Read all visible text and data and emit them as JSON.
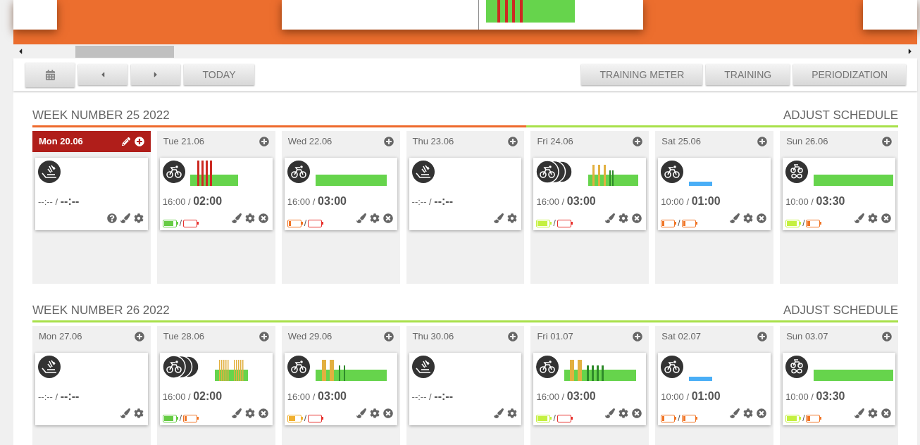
{
  "toolbar": {
    "left_buttons": [
      {
        "kind": "calendar"
      },
      {
        "kind": "prev"
      },
      {
        "kind": "next"
      },
      {
        "kind": "text",
        "label": "TODAY"
      }
    ],
    "right_buttons": [
      "TRAINING METER",
      "TRAINING",
      "PERIODIZATION"
    ]
  },
  "weeks": [
    {
      "title": "WEEK NUMBER 25 2022",
      "action": "ADJUST SCHEDULE",
      "level": 0.43,
      "days": [
        {
          "label": "Mon 20.06",
          "selected": true,
          "card": {
            "kind": "rest",
            "time": "--:-- / **--:--**",
            "help": true,
            "removable": false
          }
        },
        {
          "label": "Tue 21.06",
          "selected": false,
          "card": {
            "kind": "bike",
            "profile": {
              "kind": "red_intervals"
            },
            "time": "16:00 / **02:00**",
            "help": false,
            "removable": true,
            "batteries": {
              "planned": {
                "level": 0.85,
                "color": "#66cc44"
              },
              "separator": "/",
              "actual": {
                "color": "#e8302c"
              }
            }
          }
        },
        {
          "label": "Wed 22.06",
          "selected": false,
          "card": {
            "kind": "bike",
            "profile": {
              "kind": "flat"
            },
            "time": "16:00 / **03:00**",
            "help": false,
            "removable": true,
            "batteries": {
              "planned": {
                "level": 0.2,
                "color": "#f07424"
              },
              "separator": "/",
              "actual": {
                "color": "#e8302c"
              }
            }
          }
        },
        {
          "label": "Thu 23.06",
          "selected": false,
          "card": {
            "kind": "rest",
            "time": "--:-- / **--:--**",
            "help": false,
            "removable": false
          }
        },
        {
          "label": "Fri 24.06",
          "selected": false,
          "card": {
            "kind": "bike_multi",
            "profile": {
              "kind": "yellow_intervals"
            },
            "time": "16:00 / **03:00**",
            "help": false,
            "removable": true,
            "batteries": {
              "planned": {
                "level": 0.85,
                "color": "#c4f040"
              },
              "separator": "/",
              "actual": {
                "color": "#e8302c"
              }
            }
          }
        },
        {
          "label": "Sat 25.06",
          "selected": false,
          "card": {
            "kind": "bike",
            "profile": {
              "kind": "short_blue"
            },
            "time": "10:00 / **01:00**",
            "help": false,
            "removable": true,
            "batteries": {
              "planned": {
                "level": 0.2,
                "color": "#f07424"
              },
              "separator": "/",
              "actual": {
                "level": 0.2,
                "color": "#f07424"
              }
            }
          }
        },
        {
          "label": "Sun 26.06",
          "selected": false,
          "card": {
            "kind": "bike_loop",
            "profile": {
              "kind": "long_flat"
            },
            "time": "10:00 / **03:30**",
            "help": false,
            "removable": true,
            "batteries": {
              "planned": {
                "level": 0.85,
                "color": "#c4f040"
              },
              "separator": "/",
              "actual": {
                "level": 0.2,
                "color": "#f07424"
              }
            }
          }
        }
      ]
    },
    {
      "title": "WEEK NUMBER 26 2022",
      "action": "ADJUST SCHEDULE",
      "level": 1,
      "days": [
        {
          "label": "Mon 27.06",
          "selected": false,
          "card": {
            "kind": "rest",
            "time": "--:-- / **--:--**",
            "help": false,
            "removable": false
          }
        },
        {
          "label": "Tue 28.06",
          "selected": false,
          "card": {
            "kind": "bike_multi",
            "profile": {
              "kind": "dense_yellow"
            },
            "time": "16:00 / **02:00**",
            "help": false,
            "removable": true,
            "batteries": {
              "planned": {
                "level": 0.85,
                "color": "#66cc44"
              },
              "separator": "/",
              "actual": {
                "level": 0.2,
                "color": "#f07424"
              }
            }
          }
        },
        {
          "label": "Wed 29.06",
          "selected": false,
          "card": {
            "kind": "bike",
            "profile": {
              "kind": "wide_yellow"
            },
            "time": "16:00 / **03:00**",
            "help": false,
            "removable": true,
            "batteries": {
              "planned": {
                "level": 0.55,
                "color": "#f0b030"
              },
              "separator": "/",
              "actual": {
                "color": "#e8302c"
              }
            }
          }
        },
        {
          "label": "Thu 30.06",
          "selected": false,
          "card": {
            "kind": "rest",
            "time": "--:-- / **--:--**",
            "help": false,
            "removable": false
          }
        },
        {
          "label": "Fri 01.07",
          "selected": false,
          "card": {
            "kind": "bike",
            "profile": {
              "kind": "mixed_intervals"
            },
            "time": "16:00 / **03:00**",
            "help": false,
            "removable": true,
            "batteries": {
              "planned": {
                "level": 0.85,
                "color": "#c4f040"
              },
              "separator": "/",
              "actual": {
                "color": "#e8302c"
              }
            }
          }
        },
        {
          "label": "Sat 02.07",
          "selected": false,
          "card": {
            "kind": "bike",
            "profile": {
              "kind": "short_blue"
            },
            "time": "10:00 / **01:00**",
            "help": false,
            "removable": true,
            "batteries": {
              "planned": {
                "level": 0.2,
                "color": "#f07424"
              },
              "separator": "/",
              "actual": {
                "level": 0.2,
                "color": "#f07424"
              }
            }
          }
        },
        {
          "label": "Sun 03.07",
          "selected": false,
          "card": {
            "kind": "bike_loop",
            "profile": {
              "kind": "long_flat"
            },
            "time": "10:00 / **03:30**",
            "help": false,
            "removable": true,
            "batteries": {
              "planned": {
                "level": 0.85,
                "color": "#c4f040"
              },
              "separator": "/",
              "actual": {
                "level": 0.2,
                "color": "#f07424"
              }
            }
          }
        }
      ]
    }
  ]
}
